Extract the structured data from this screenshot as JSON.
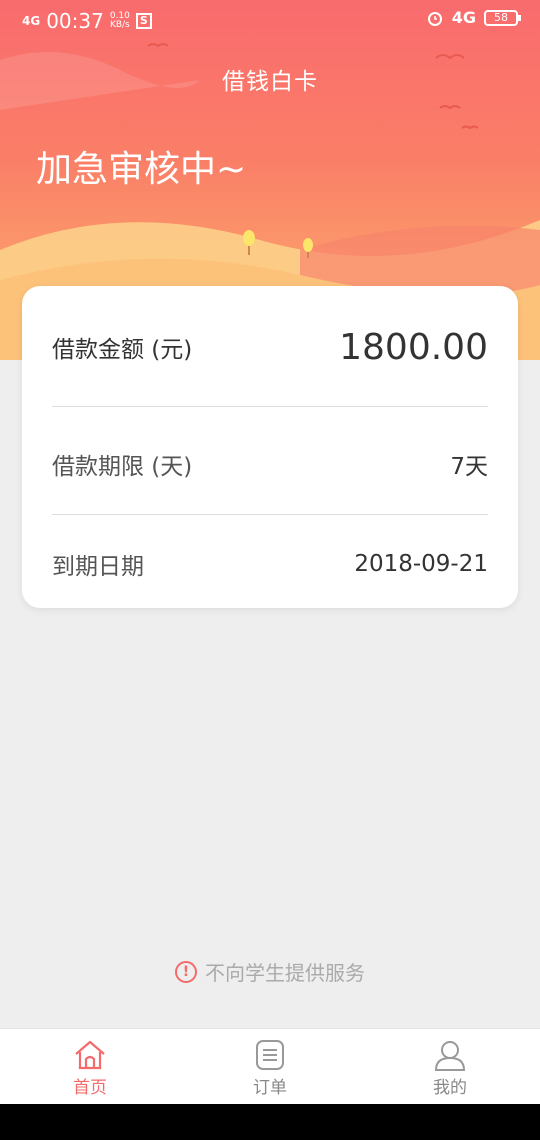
{
  "status_bar": {
    "network_left": "4G",
    "time": "00:37",
    "speed_value": "0.10",
    "speed_unit": "KB/s",
    "app_icon": "S",
    "network_right": "4G",
    "battery": "58"
  },
  "header": {
    "title": "借钱白卡",
    "status": "加急审核中~"
  },
  "loan": {
    "amount_label": "借款金额 (元)",
    "amount_value": "1800.00",
    "term_label": "借款期限 (天)",
    "term_value": "7天",
    "due_label": "到期日期",
    "due_value": "2018-09-21"
  },
  "notice": {
    "text": "不向学生提供服务"
  },
  "tabs": [
    {
      "label": "首页",
      "icon": "home-icon",
      "active": true
    },
    {
      "label": "订单",
      "icon": "order-list-icon",
      "active": false
    },
    {
      "label": "我的",
      "icon": "user-icon",
      "active": false
    }
  ],
  "colors": {
    "accent": "#f56a6a",
    "hero_top": "#f96b6e",
    "hero_bottom": "#fcb36e",
    "background": "#eeeeee"
  }
}
